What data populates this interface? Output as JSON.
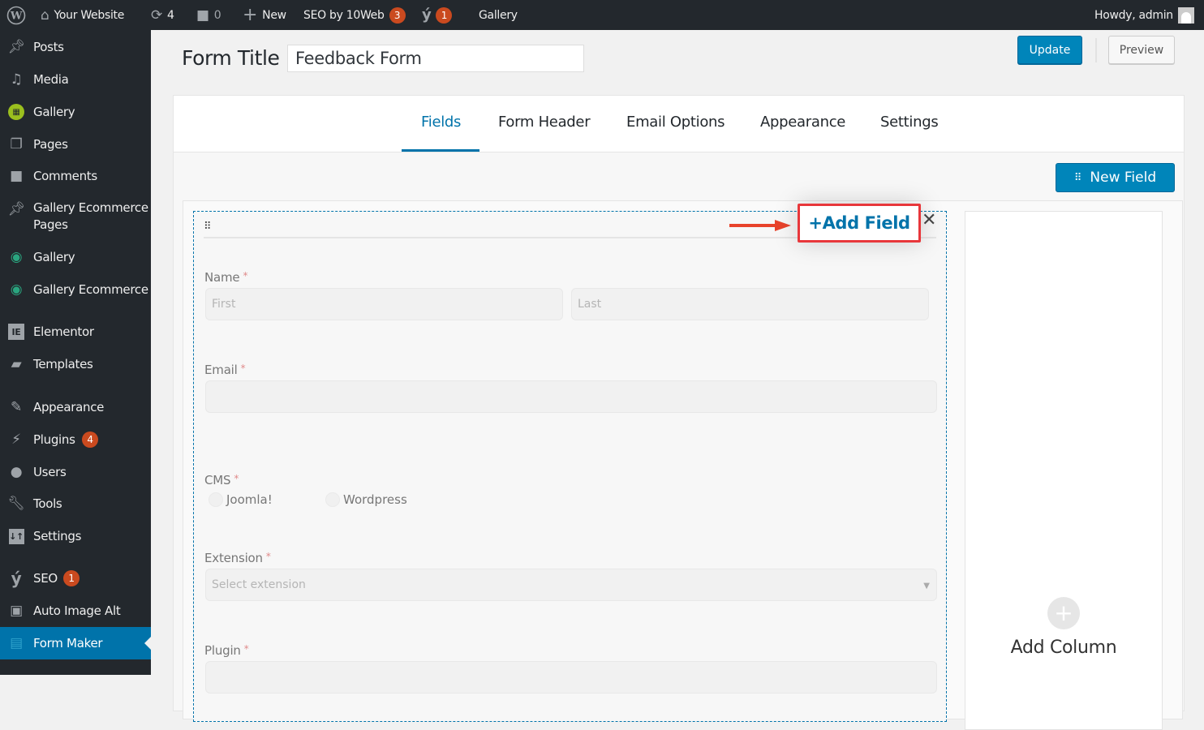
{
  "admin_bar": {
    "site_name": "Your Website",
    "updates_count": "4",
    "comments_count": "0",
    "new_label": "New",
    "seo_label": "SEO by 10Web",
    "seo_badge": "3",
    "yoast_badge": "1",
    "gallery_label": "Gallery",
    "howdy": "Howdy, admin"
  },
  "sidebar": {
    "items": [
      {
        "label": "Posts",
        "icon": "pin-icon"
      },
      {
        "label": "Media",
        "icon": "media-icon"
      },
      {
        "label": "Gallery",
        "icon": "gallery-icon"
      },
      {
        "label": "Pages",
        "icon": "pages-icon"
      },
      {
        "label": "Comments",
        "icon": "comment-icon"
      },
      {
        "label": "Gallery Ecommerce Pages",
        "icon": "pin-icon"
      },
      {
        "label": "Gallery",
        "icon": "camera-icon"
      },
      {
        "label": "Gallery Ecommerce",
        "icon": "camera-icon"
      },
      {
        "label": "Elementor",
        "icon": "elementor-icon"
      },
      {
        "label": "Templates",
        "icon": "folder-icon"
      },
      {
        "label": "Appearance",
        "icon": "brush-icon"
      },
      {
        "label": "Plugins",
        "icon": "plug-icon",
        "badge": "4"
      },
      {
        "label": "Users",
        "icon": "user-icon"
      },
      {
        "label": "Tools",
        "icon": "wrench-icon"
      },
      {
        "label": "Settings",
        "icon": "sliders-icon"
      },
      {
        "label": "SEO",
        "icon": "yoast-icon",
        "badge": "1"
      },
      {
        "label": "Auto Image Alt",
        "icon": "image-icon"
      },
      {
        "label": "Form Maker",
        "icon": "form-icon",
        "active": true
      }
    ]
  },
  "header": {
    "form_title_label": "Form Title",
    "form_title_value": "Feedback Form",
    "update_label": "Update",
    "preview_label": "Preview"
  },
  "tabs": [
    {
      "label": "Fields",
      "active": true
    },
    {
      "label": "Form Header"
    },
    {
      "label": "Email Options"
    },
    {
      "label": "Appearance"
    },
    {
      "label": "Settings"
    }
  ],
  "toolbar": {
    "new_field_label": "New Field",
    "add_field_label": "Add Field",
    "add_column_label": "Add Column"
  },
  "form": {
    "name": {
      "label": "Name",
      "required": "*",
      "first_placeholder": "First",
      "last_placeholder": "Last"
    },
    "email": {
      "label": "Email",
      "required": "*",
      "value": ""
    },
    "cms": {
      "label": "CMS",
      "required": "*",
      "options": [
        "Joomla!",
        "Wordpress"
      ]
    },
    "extension": {
      "label": "Extension",
      "required": "*",
      "placeholder": "Select extension"
    },
    "plugin": {
      "label": "Plugin",
      "required": "*"
    }
  },
  "colors": {
    "accent": "#0073aa",
    "admin_bar": "#23282d",
    "badge": "#ca4a1f",
    "highlight": "#e8373b"
  }
}
